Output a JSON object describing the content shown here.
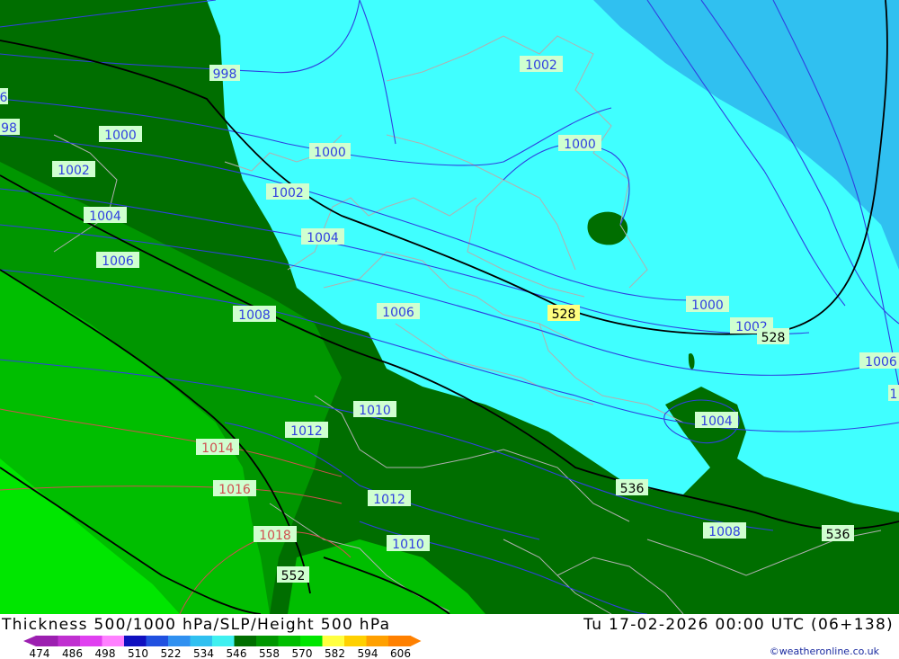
{
  "map": {
    "slp_labels": [
      "998",
      "1000",
      "1000",
      "1002",
      "1004",
      "1006",
      "1008",
      "1010",
      "1012",
      "1014",
      "1016",
      "1018",
      "1002",
      "1000",
      "1002",
      "1004",
      "1006",
      "1008",
      "1010",
      "1012",
      "1000",
      "1002",
      "1004",
      "1006",
      "6",
      "98",
      "1"
    ],
    "height_labels": [
      "528",
      "528",
      "536",
      "536",
      "552"
    ]
  },
  "footer": {
    "title": "Thickness 500/1000 hPa/SLP/Height 500 hPa",
    "datetime": "Tu 17-02-2026 00:00 UTC (06+138)",
    "credit": "©weatheronline.co.uk"
  },
  "legend": {
    "ticks": [
      "474",
      "486",
      "498",
      "510",
      "522",
      "534",
      "546",
      "558",
      "570",
      "582",
      "594",
      "606"
    ],
    "colors": [
      "#9c1fb0",
      "#c030d0",
      "#e040f0",
      "#ff80ff",
      "#1010c0",
      "#2050e0",
      "#3090f0",
      "#30c0f0",
      "#40f0f0",
      "#006e00",
      "#009600",
      "#00be00",
      "#00e600",
      "#ffff40",
      "#ffd000",
      "#ffa000",
      "#ff8000"
    ]
  },
  "colors": {
    "cyan_light": "#40ffff",
    "cyan_mid": "#30c0f0",
    "green_dark": "#006e00",
    "green_mid": "#009600",
    "green_bright": "#00be00",
    "green_light": "#00e600",
    "isobar_blue": "#3040e0",
    "isobar_red": "#d05050",
    "height_line": "#000000",
    "border_grey": "#b0b0b0",
    "label_bg": "#d0ffd0"
  }
}
